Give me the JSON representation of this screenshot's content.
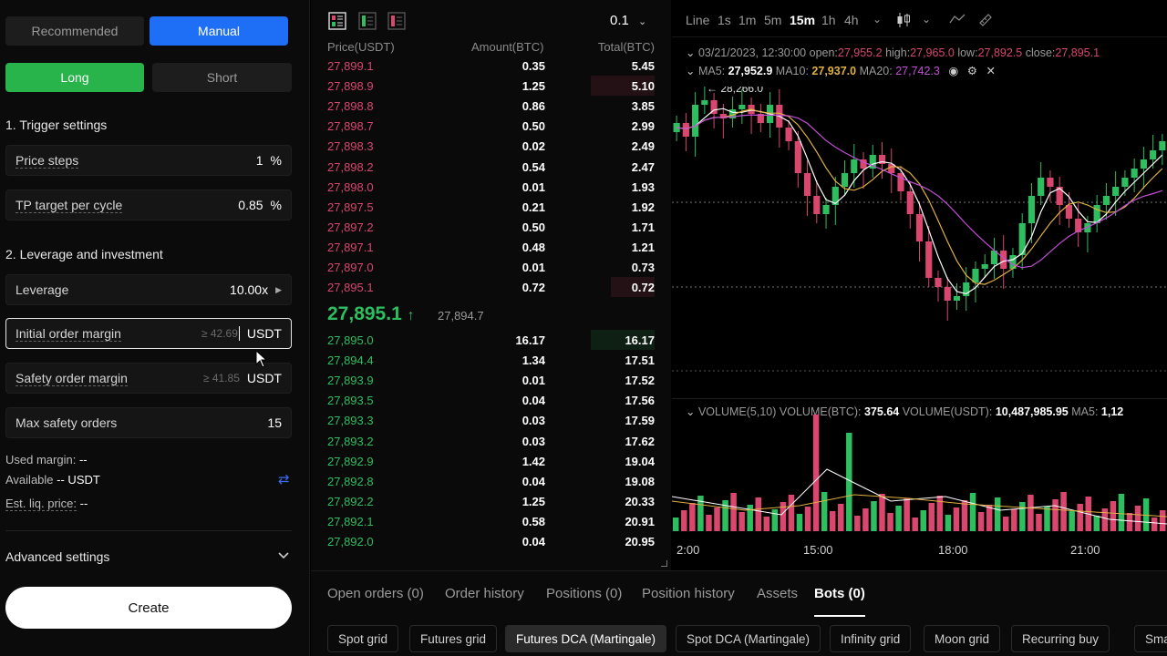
{
  "mode_tabs": {
    "recommended": "Recommended",
    "manual": "Manual"
  },
  "direction": {
    "long": "Long",
    "short": "Short"
  },
  "trigger": {
    "title": "1. Trigger settings",
    "price_steps_label": "Price steps",
    "price_steps_value": "1",
    "price_steps_unit": "%",
    "tp_label": "TP target per cycle",
    "tp_value": "0.85",
    "tp_unit": "%"
  },
  "leverage_section": {
    "title": "2. Leverage and investment",
    "leverage_label": "Leverage",
    "leverage_value": "10.00x",
    "initial_label": "Initial order margin",
    "initial_placeholder": "≥ 42.69",
    "initial_unit": "USDT",
    "safety_label": "Safety order margin",
    "safety_placeholder": "≥ 41.85",
    "safety_unit": "USDT",
    "max_label": "Max safety orders",
    "max_value": "15"
  },
  "summary": {
    "used_label": "Used margin:",
    "used_value": "--",
    "avail_label": "Available",
    "avail_value": "-- USDT",
    "liq_label": "Est. liq. price:",
    "liq_value": "--"
  },
  "advanced": "Advanced settings",
  "create": "Create",
  "orderbook": {
    "precision": "0.1",
    "headers": {
      "price": "Price(USDT)",
      "amount": "Amount(BTC)",
      "total": "Total(BTC)"
    },
    "asks": [
      {
        "p": "27,899.1",
        "a": "0.35",
        "t": "5.45",
        "d": 0.0
      },
      {
        "p": "27,898.9",
        "a": "1.25",
        "t": "5.10",
        "d": 0.22
      },
      {
        "p": "27,898.8",
        "a": "0.86",
        "t": "3.85",
        "d": 0.0
      },
      {
        "p": "27,898.7",
        "a": "0.50",
        "t": "2.99",
        "d": 0.0
      },
      {
        "p": "27,898.3",
        "a": "0.02",
        "t": "2.49",
        "d": 0.0
      },
      {
        "p": "27,898.2",
        "a": "0.54",
        "t": "2.47",
        "d": 0.0
      },
      {
        "p": "27,898.0",
        "a": "0.01",
        "t": "1.93",
        "d": 0.0
      },
      {
        "p": "27,897.5",
        "a": "0.21",
        "t": "1.92",
        "d": 0.0
      },
      {
        "p": "27,897.2",
        "a": "0.50",
        "t": "1.71",
        "d": 0.0
      },
      {
        "p": "27,897.1",
        "a": "0.48",
        "t": "1.21",
        "d": 0.0
      },
      {
        "p": "27,897.0",
        "a": "0.01",
        "t": "0.73",
        "d": 0.0
      },
      {
        "p": "27,895.1",
        "a": "0.72",
        "t": "0.72",
        "d": 0.15
      }
    ],
    "last_price": "27,895.1",
    "mark_price": "27,894.7",
    "bids": [
      {
        "p": "27,895.0",
        "a": "16.17",
        "t": "16.17",
        "d": 0.22
      },
      {
        "p": "27,894.4",
        "a": "1.34",
        "t": "17.51",
        "d": 0.0
      },
      {
        "p": "27,893.9",
        "a": "0.01",
        "t": "17.52",
        "d": 0.0
      },
      {
        "p": "27,893.5",
        "a": "0.04",
        "t": "17.56",
        "d": 0.0
      },
      {
        "p": "27,893.3",
        "a": "0.03",
        "t": "17.59",
        "d": 0.0
      },
      {
        "p": "27,893.2",
        "a": "0.03",
        "t": "17.62",
        "d": 0.0
      },
      {
        "p": "27,892.9",
        "a": "1.42",
        "t": "19.04",
        "d": 0.0
      },
      {
        "p": "27,892.8",
        "a": "0.04",
        "t": "19.08",
        "d": 0.0
      },
      {
        "p": "27,892.2",
        "a": "1.25",
        "t": "20.33",
        "d": 0.0
      },
      {
        "p": "27,892.1",
        "a": "0.58",
        "t": "20.91",
        "d": 0.0
      },
      {
        "p": "27,892.0",
        "a": "0.04",
        "t": "20.95",
        "d": 0.0
      }
    ]
  },
  "chart": {
    "timeframes": [
      "Line",
      "1s",
      "1m",
      "5m",
      "15m",
      "1h",
      "4h"
    ],
    "active_tf": "15m",
    "ohlc": {
      "date": "03/21/2023, 12:30:00",
      "open_l": "open:",
      "open": "27,955.2",
      "high_l": "high:",
      "high": "27,965.0",
      "low_l": "low:",
      "low": "27,892.5",
      "close_l": "close:",
      "close": "27,895.1"
    },
    "ma": {
      "ma5_l": "MA5:",
      "ma5": "27,952.9",
      "ma10_l": "MA10:",
      "ma10": "27,937.0",
      "ma20_l": "MA20:",
      "ma20": "27,742.3"
    },
    "high_marker": "28,266.0",
    "volume": {
      "label": "VOLUME(5,10)",
      "btc_l": "VOLUME(BTC):",
      "btc": "375.64",
      "usdt_l": "VOLUME(USDT):",
      "usdt": "10,487,985.95",
      "ma5_l": "MA5:",
      "ma5": "1,12"
    },
    "xaxis": [
      "2:00",
      "15:00",
      "18:00",
      "21:00"
    ],
    "colors": {
      "up": "#2ebd5f",
      "down": "#d9466e",
      "ma5": "#ffffff",
      "ma10": "#e0b040",
      "ma20": "#c24fd6"
    }
  },
  "bottom_tabs": [
    "Open orders (0)",
    "Order history",
    "Positions (0)",
    "Position history",
    "Assets",
    "Bots (0)"
  ],
  "bot_types": [
    "Spot grid",
    "Futures grid",
    "Futures DCA (Martingale)",
    "Spot DCA (Martingale)",
    "Infinity grid",
    "Moon grid",
    "Recurring buy",
    "Smart"
  ]
}
